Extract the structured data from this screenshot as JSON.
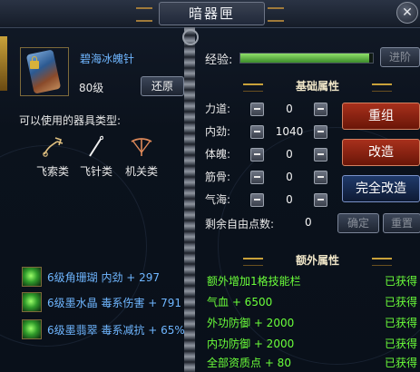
{
  "window": {
    "title": "暗器匣"
  },
  "weapon": {
    "name": "碧海冰魄针",
    "level": "80级",
    "restore_label": "还原"
  },
  "types": {
    "label": "可以使用的器具类型:",
    "items": [
      {
        "label": "飞索类",
        "icon": "grappling-hook-icon"
      },
      {
        "label": "飞针类",
        "icon": "flying-needle-icon"
      },
      {
        "label": "机关类",
        "icon": "crossbow-mechanism-icon"
      }
    ]
  },
  "exp": {
    "label": "经验:",
    "progress": 0.97,
    "advance_label": "进阶"
  },
  "basic_attributes": {
    "header": "基础属性",
    "stats": [
      {
        "name": "力道:",
        "value": "0"
      },
      {
        "name": "内劲:",
        "value": "1040"
      },
      {
        "name": "体魄:",
        "value": "0"
      },
      {
        "name": "筋骨:",
        "value": "0"
      },
      {
        "name": "气海:",
        "value": "0"
      }
    ],
    "free_points_label": "剩余自由点数:",
    "free_points_value": "0",
    "confirm_label": "确定",
    "reset_label": "重置"
  },
  "actions": {
    "regroup_label": "重组",
    "modify_label": "改造",
    "full_modify_label": "完全改造"
  },
  "gems": [
    {
      "text": "6级角珊瑚 内劲 + 297"
    },
    {
      "text": "6级墨水晶 毒系伤害 + 791"
    },
    {
      "text": "6级墨翡翠 毒系减抗 + 65%"
    }
  ],
  "extra_attributes": {
    "header": "额外属性",
    "items": [
      {
        "name": "额外增加1格技能栏",
        "status": "已获得"
      },
      {
        "name": "气血 + 6500",
        "status": "已获得"
      },
      {
        "name": "外功防御 + 2000",
        "status": "已获得"
      },
      {
        "name": "内功防御 + 2000",
        "status": "已获得"
      },
      {
        "name": "全部资质点 + 80",
        "status": "已获得"
      }
    ]
  },
  "colors": {
    "name_blue": "#6fb6ff",
    "status_green": "#6bff3a",
    "button_red": "#a8301c",
    "button_blue": "#1f3a6a",
    "exp_green": "#6fd04a"
  }
}
